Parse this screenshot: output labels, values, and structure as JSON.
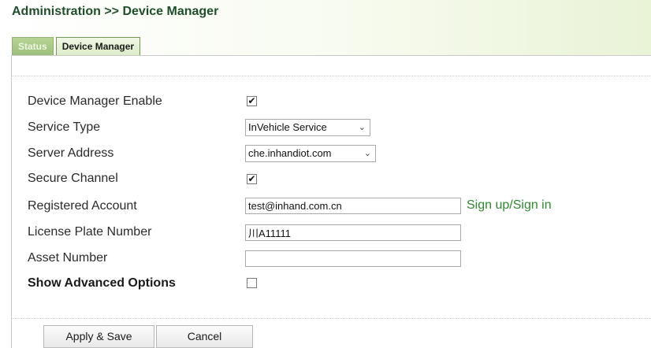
{
  "header": {
    "breadcrumb": "Administration >> Device Manager"
  },
  "tabs": [
    {
      "label": "Status",
      "active": false
    },
    {
      "label": "Device Manager",
      "active": true
    }
  ],
  "form": {
    "device_manager_enable": {
      "label": "Device Manager Enable",
      "checked": true,
      "mark": "✔"
    },
    "service_type": {
      "label": "Service Type",
      "value": "InVehicle Service"
    },
    "server_address": {
      "label": "Server Address",
      "value": "che.inhandiot.com"
    },
    "secure_channel": {
      "label": "Secure Channel",
      "checked": true,
      "mark": "✔"
    },
    "registered_account": {
      "label": "Registered Account",
      "value": "test@inhand.com.cn",
      "link": "Sign up/Sign in"
    },
    "license_plate_number": {
      "label": "License Plate Number",
      "value": "川A11111"
    },
    "asset_number": {
      "label": "Asset Number",
      "value": ""
    },
    "show_advanced_options": {
      "label": "Show Advanced Options",
      "checked": false
    }
  },
  "actions": {
    "apply_save": "Apply & Save",
    "cancel": "Cancel"
  },
  "icons": {
    "dropdown": "chevron-down-icon",
    "check": "checkmark-icon"
  },
  "colors": {
    "title": "#1f4f2a",
    "link": "#2e8b2e",
    "tab_active_bg": "#dcecc8",
    "tab_inactive_bg": "#9cc07a"
  }
}
